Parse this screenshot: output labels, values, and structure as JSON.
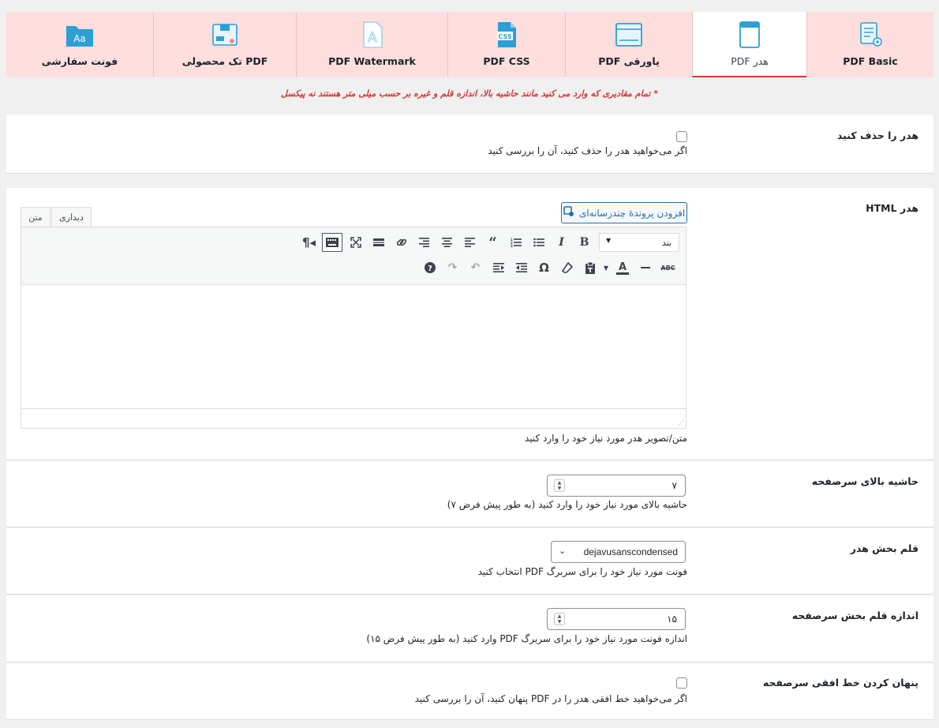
{
  "tabs": [
    {
      "label": "PDF Basic",
      "icon": "document-settings-icon",
      "active": false
    },
    {
      "label": "هدر PDF",
      "icon": "page-header-icon",
      "active": true
    },
    {
      "label": "پاورقی PDF",
      "icon": "browser-window-icon",
      "active": false
    },
    {
      "label": "PDF CSS",
      "icon": "css-file-icon",
      "active": false
    },
    {
      "label": "PDF Watermark",
      "icon": "watermark-file-icon",
      "active": false
    },
    {
      "label": "PDF تک محصولی",
      "icon": "product-box-icon",
      "active": false
    },
    {
      "label": "فونت سفارشی",
      "icon": "font-folder-icon",
      "active": false
    }
  ],
  "note": "* تمام مقادیری که وارد می کنید مانند حاشیه بالا، اندازه قلم و غیره بر حسب میلی متر هستند نه پیکسل",
  "remove_header": {
    "label": "هدر را حذف کنید",
    "checked": false,
    "description": "اگر می‌خواهید هدر را حذف کنید، آن را بررسی کنید"
  },
  "header_html": {
    "label": "هدر HTML",
    "add_media": "افزودن پروندهٔ چندرسانه‌ای",
    "tab_visual": "دیداری",
    "tab_text": "متن",
    "format_select": "بند",
    "description": "متن/تصویر هدر مورد نیاز خود را وارد کنید"
  },
  "top_margin": {
    "label": "حاشیه بالای سرصفحه",
    "value": "۷",
    "description": "حاشیه بالای مورد نیاز خود را وارد کنید (به طور پیش فرض ۷)"
  },
  "header_font": {
    "label": "قلم بخش هدر",
    "value": "dejavusanscondensed",
    "description": "فونت مورد نیاز خود را برای سربرگ PDF انتخاب کنید"
  },
  "header_font_size": {
    "label": "اندازه قلم بخش سرصفحه",
    "value": "۱۵",
    "description": "اندازه فونت مورد نیاز خود را برای سربرگ PDF وارد کنید (به طور پیش فرض ۱۵)"
  },
  "hide_hr": {
    "label": "پنهان کردن خط افقی سرصفحه",
    "checked": false,
    "description": "اگر می‌خواهید خط افقی هدر را در PDF پنهان کنید، آن را بررسی کنید"
  },
  "colors": {
    "tab_bg": "#ffdede",
    "accent_red": "#d63638",
    "icon_blue": "#2c9fd6",
    "link_blue": "#2271b1"
  }
}
